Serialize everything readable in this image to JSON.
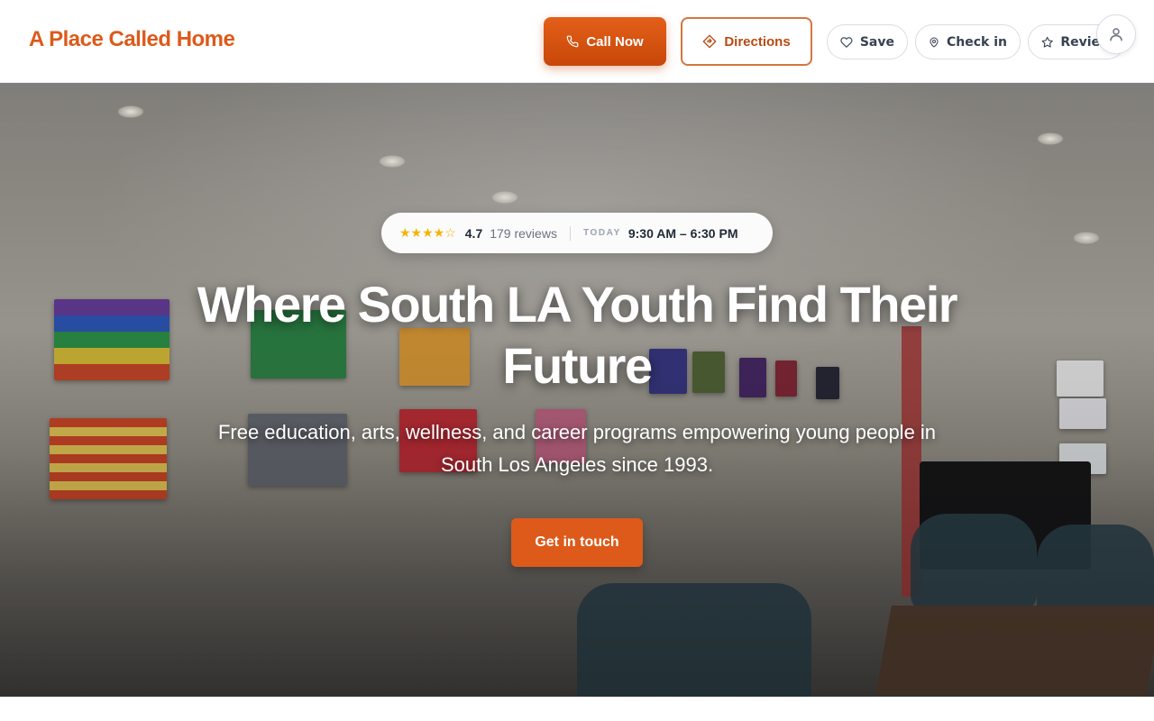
{
  "header": {
    "brand": "A Place Called Home",
    "call_label": "Call Now",
    "directions_label": "Directions",
    "save_label": "Save",
    "checkin_label": "Check in",
    "review_label": "Review"
  },
  "hero": {
    "stars": "★★★★☆",
    "rating": "4.7",
    "reviews": "179 reviews",
    "today_label": "TODAY",
    "hours": "9:30 AM – 6:30 PM",
    "title": "Where South LA Youth Find Their Future",
    "subtitle": "Free education, arts, wellness, and career programs empowering young people in South Los Angeles since 1993.",
    "cta_label": "Get in touch"
  },
  "colors": {
    "brand": "#dd5a1a",
    "star": "#f5b400"
  },
  "icons": [
    "phone-icon",
    "directions-icon",
    "heart-icon",
    "map-pin-icon",
    "star-icon",
    "user-icon"
  ]
}
